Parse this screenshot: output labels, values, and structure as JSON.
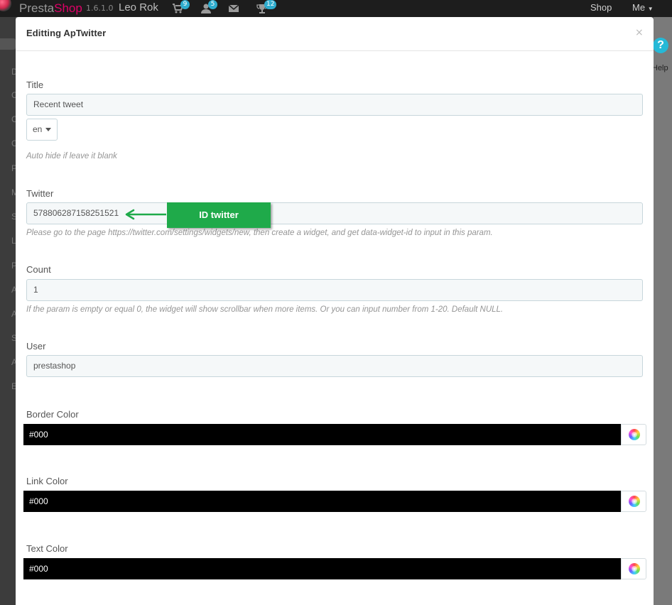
{
  "topbar": {
    "brand_presta": "Presta",
    "brand_shop": "Shop",
    "version": "1.6.1.0",
    "store_name": "Leo Rok",
    "icons": [
      {
        "name": "cart-icon",
        "badge": "9"
      },
      {
        "name": "customers-icon",
        "badge": "5"
      },
      {
        "name": "messages-icon",
        "badge": ""
      },
      {
        "name": "trophy-icon",
        "badge": "12"
      }
    ],
    "shop_link": "Shop",
    "me_menu": "Me",
    "badge_color": "#2eacce"
  },
  "background": {
    "help_label": "Help",
    "sidebar_letters": [
      "D",
      "C",
      "C",
      "C",
      "P",
      "M",
      "S",
      "L",
      "P",
      "A",
      "A",
      "S",
      "A",
      "E"
    ]
  },
  "modal": {
    "title": "Editting ApTwitter",
    "close": "×",
    "fields": {
      "title_label": "Title",
      "title_value": "Recent tweet",
      "lang_value": "en",
      "title_help": "Auto hide if leave it blank",
      "twitter_label": "Twitter",
      "twitter_value": "578806287158251521",
      "twitter_help": "Please go to the page https://twitter.com/settings/widgets/new, then create a widget, and get data-widget-id to input in this param.",
      "count_label": "Count",
      "count_value": "1",
      "count_help": "If the param is empty or equal 0, the widget will show scrollbar when more items. Or you can input number from 1-20. Default NULL.",
      "user_label": "User",
      "user_value": "prestashop",
      "border_color_label": "Border Color",
      "border_color_value": "#000",
      "link_color_label": "Link Color",
      "link_color_value": "#000",
      "text_color_label": "Text Color",
      "text_color_value": "#000"
    }
  },
  "annotation": {
    "label": "ID twitter",
    "color": "#1faa4a"
  }
}
